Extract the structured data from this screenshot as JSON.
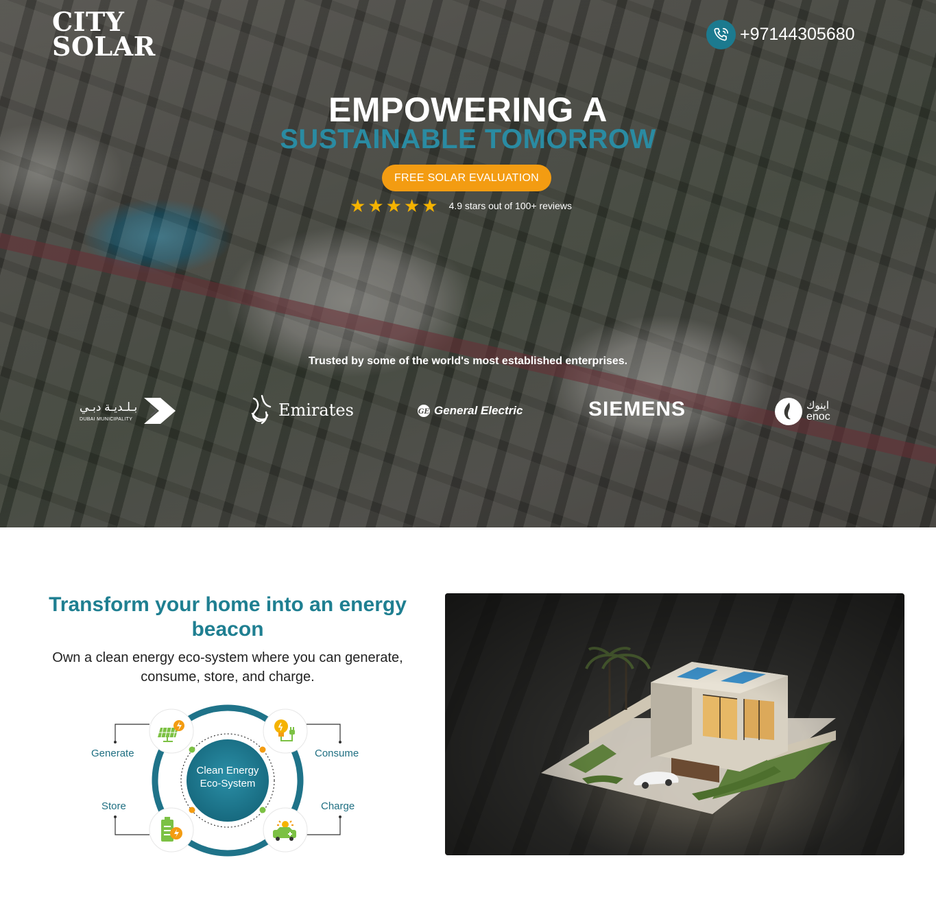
{
  "brand": {
    "line1": "CITY",
    "line2": "SOLAR"
  },
  "header": {
    "phone": "+97144305680"
  },
  "hero": {
    "title": "EMPOWERING A",
    "subtitle": "SUSTAINABLE TOMORROW",
    "cta_label": "FREE SOLAR EVALUATION",
    "stars": 5,
    "rating_text": "4.9 stars out of 100+ reviews",
    "trusted_text": "Trusted by some of the world's most established enterprises.",
    "accent_color": "#2a8ba2",
    "cta_color": "#f39c12"
  },
  "partners": {
    "dubai": {
      "arabic": "بـلـديـة دبـي",
      "english": "DUBAI MUNICIPALITY"
    },
    "emirates": {
      "english": "Emirates"
    },
    "ge": {
      "english": "General Electric"
    },
    "siemens": {
      "english": "SIEMENS"
    },
    "enoc": {
      "arabic": "اينوك",
      "english": "enoc"
    }
  },
  "feature": {
    "title": "Transform your home into an energy beacon",
    "description": "Own a clean energy eco-system where you can generate, consume, store, and charge.",
    "title_color": "#1f7f91"
  },
  "ecosystem": {
    "center": "Clean Energy Eco-System",
    "generate": "Generate",
    "consume": "Consume",
    "store": "Store",
    "charge": "Charge"
  }
}
